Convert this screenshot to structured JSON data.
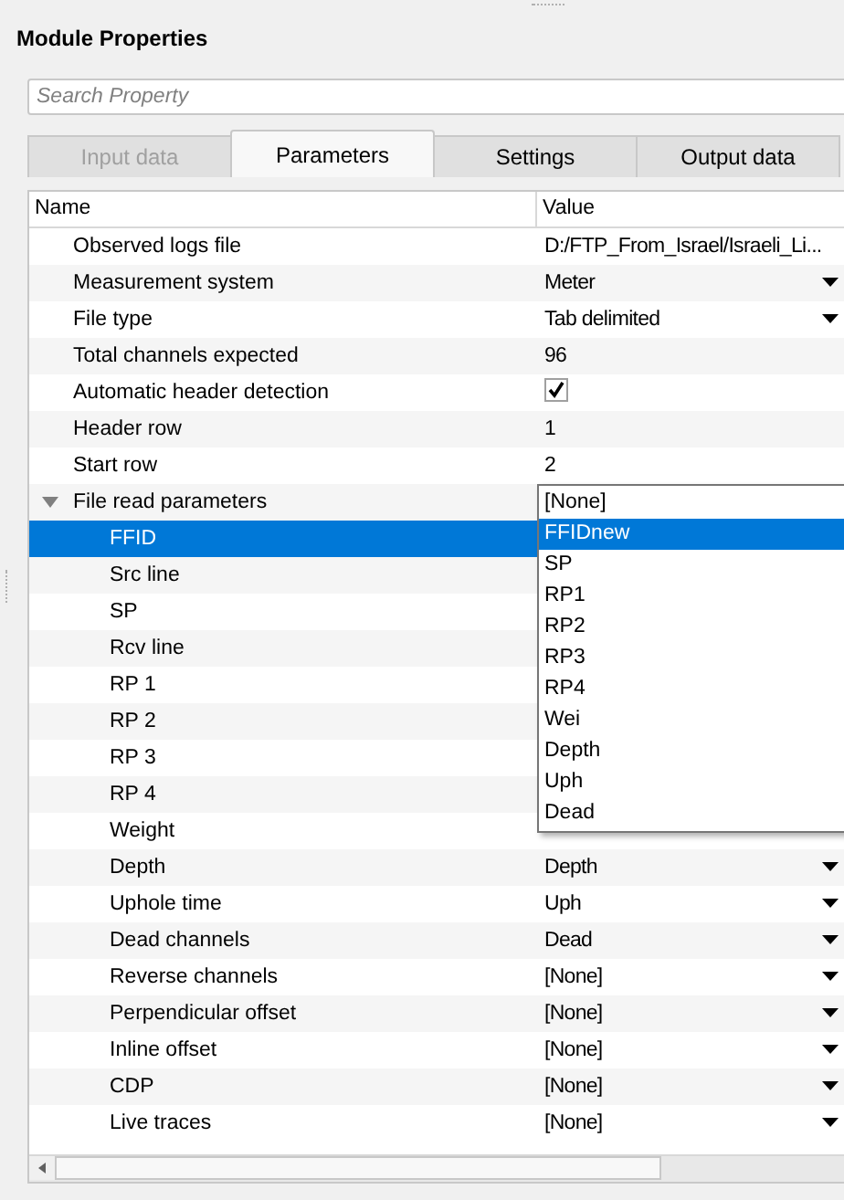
{
  "panel": {
    "title": "Module Properties"
  },
  "search": {
    "placeholder": "Search Property"
  },
  "tabs": [
    {
      "label": "Input data",
      "selected": false,
      "disabled": true
    },
    {
      "label": "Parameters",
      "selected": true,
      "disabled": false
    },
    {
      "label": "Settings",
      "selected": false,
      "disabled": false
    },
    {
      "label": "Output data",
      "selected": false,
      "disabled": false
    }
  ],
  "table": {
    "columns": [
      "Name",
      "Value"
    ],
    "rows": [
      {
        "name": "Observed logs file",
        "value": "D:/FTP_From_Israel/Israeli_Li...",
        "kind": "text",
        "selected": false
      },
      {
        "name": "Measurement system",
        "value": "Meter",
        "kind": "dropdown",
        "selected": false
      },
      {
        "name": "File type",
        "value": "Tab delimited",
        "kind": "dropdown",
        "selected": false
      },
      {
        "name": "Total channels expected",
        "value": "96",
        "kind": "text",
        "selected": false
      },
      {
        "name": "Automatic header detection",
        "kind": "checkbox",
        "checked": true,
        "selected": false
      },
      {
        "name": "Header row",
        "value": "1",
        "kind": "text",
        "selected": false
      },
      {
        "name": "Start row",
        "value": "2",
        "kind": "text",
        "selected": false
      },
      {
        "name": "File read parameters",
        "expanded": true,
        "selected": false,
        "children": [
          {
            "name": "FFID",
            "selected": true
          },
          {
            "name": "Src line",
            "selected": false
          },
          {
            "name": "SP",
            "selected": false
          },
          {
            "name": "Rcv line",
            "selected": false
          },
          {
            "name": "RP 1",
            "selected": false
          },
          {
            "name": "RP 2",
            "selected": false
          },
          {
            "name": "RP 3",
            "selected": false
          },
          {
            "name": "RP 4",
            "selected": false
          },
          {
            "name": "Weight",
            "selected": false
          },
          {
            "name": "Depth",
            "value": "Depth",
            "kind": "dropdown",
            "selected": false
          },
          {
            "name": "Uphole time",
            "value": "Uph",
            "kind": "dropdown",
            "selected": false
          },
          {
            "name": "Dead channels",
            "value": "Dead",
            "kind": "dropdown",
            "selected": false
          },
          {
            "name": "Reverse channels",
            "value": "[None]",
            "kind": "dropdown",
            "selected": false
          },
          {
            "name": "Perpendicular offset",
            "value": "[None]",
            "kind": "dropdown",
            "selected": false
          },
          {
            "name": "Inline offset",
            "value": "[None]",
            "kind": "dropdown",
            "selected": false
          },
          {
            "name": "CDP",
            "value": "[None]",
            "kind": "dropdown",
            "selected": false
          },
          {
            "name": "Live traces",
            "value": "[None]",
            "kind": "dropdown",
            "selected": false
          }
        ]
      }
    ]
  },
  "dropdown_list": {
    "options": [
      {
        "label": "[None]",
        "selected": false
      },
      {
        "label": "FFIDnew",
        "selected": true
      },
      {
        "label": "SP",
        "selected": false
      },
      {
        "label": "RP1",
        "selected": false
      },
      {
        "label": "RP2",
        "selected": false
      },
      {
        "label": "RP3",
        "selected": false
      },
      {
        "label": "RP4",
        "selected": false
      },
      {
        "label": "Wei",
        "selected": false
      },
      {
        "label": "Depth",
        "selected": false
      },
      {
        "label": "Uph",
        "selected": false
      },
      {
        "label": "Dead",
        "selected": false
      }
    ]
  }
}
